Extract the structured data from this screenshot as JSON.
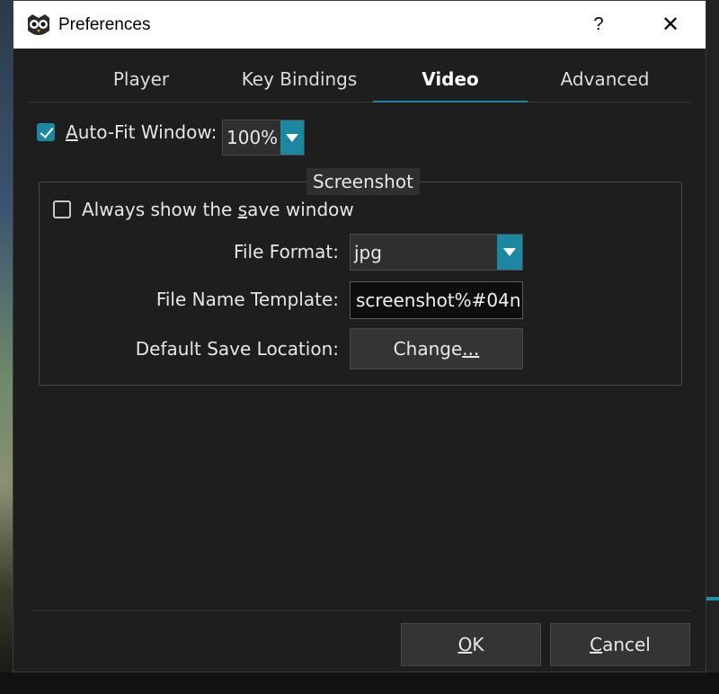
{
  "window": {
    "title": "Preferences",
    "help": "?",
    "close": "✕"
  },
  "tabs": [
    {
      "label": "Player",
      "active": false
    },
    {
      "label": "Key Bindings",
      "active": false
    },
    {
      "label": "Video",
      "active": true
    },
    {
      "label": "Advanced",
      "active": false
    }
  ],
  "video": {
    "autofit": {
      "label": "Auto-Fit Window:",
      "checked": true,
      "value": "100%"
    },
    "screenshot": {
      "group_title": "Screenshot",
      "always_show": {
        "label": "Always show the save window",
        "checked": false
      },
      "file_format": {
        "label": "File Format:",
        "value": "jpg"
      },
      "file_name_template": {
        "label": "File Name Template:",
        "value": "screenshot%#04n"
      },
      "default_save_location": {
        "label": "Default Save Location:",
        "button": "Change..."
      }
    }
  },
  "footer": {
    "ok": "OK",
    "cancel": "Cancel"
  },
  "colors": {
    "accent": "#1b87a0",
    "background": "#1e1e1e",
    "titlebar": "#ffffff"
  },
  "icons": {
    "app": "owl-icon",
    "dropdown": "chevron-down-icon"
  }
}
